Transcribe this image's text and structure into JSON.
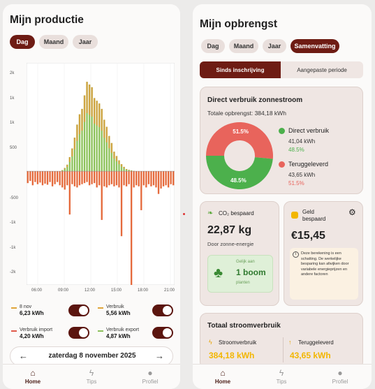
{
  "production": {
    "title": "Mijn productie",
    "tabs": [
      {
        "label": "Dag",
        "active": true
      },
      {
        "label": "Maand",
        "active": false
      },
      {
        "label": "Jaar",
        "active": false
      }
    ],
    "y_ticks": [
      "2k",
      "1k",
      "1k",
      "500",
      "-500",
      "-1k",
      "-1k",
      "-2k"
    ],
    "x_ticks": [
      "06:00",
      "09:00",
      "12:00",
      "15:00",
      "18:00",
      "21:00"
    ],
    "legend": [
      {
        "label": "8 nov",
        "value": "6,23 kWh",
        "color": "#e0a53a"
      },
      {
        "label": "Verbruik",
        "value": "5,56 kWh",
        "color": "#e0a53a"
      },
      {
        "label": "Verbruik import",
        "value": "4,20 kWh",
        "color": "#e05a4a"
      },
      {
        "label": "Verbruik export",
        "value": "4,87 kWh",
        "color": "#8cbf5a"
      }
    ],
    "date_label": "zaterdag 8 november 2025",
    "prev_icon": "arrow-left-icon",
    "next_icon": "arrow-right-icon"
  },
  "chart_data": {
    "type": "bar",
    "colors": {
      "production_top": "#e59a3a",
      "production_fill": "#8cc25a",
      "consumption": "#e56a3c"
    },
    "x": [
      "06:00",
      "09:00",
      "12:00",
      "15:00",
      "18:00",
      "21:00"
    ],
    "series": [
      {
        "values": [
          0,
          0,
          0,
          0,
          0,
          0,
          0,
          0,
          0,
          0,
          0,
          0,
          0,
          0,
          20,
          60,
          120,
          260,
          420,
          620,
          860,
          1050,
          1150,
          1400,
          1650,
          1600,
          1550,
          1350,
          1300,
          1250,
          1150,
          950,
          820,
          650,
          520,
          360,
          280,
          200,
          130,
          80,
          40,
          25,
          15,
          5,
          0,
          0,
          0,
          0,
          0,
          0,
          0,
          0,
          0,
          0,
          0,
          0,
          0,
          0,
          0,
          0
        ]
      },
      {
        "values": [
          -220,
          -180,
          -260,
          -200,
          -240,
          -210,
          -260,
          -230,
          -250,
          -200,
          -280,
          -240,
          -200,
          -260,
          -300,
          -340,
          -260,
          -800,
          -240,
          -280,
          -300,
          -260,
          -240,
          -220,
          -200,
          -260,
          -240,
          -220,
          -300,
          -260,
          -900,
          -280,
          -300,
          -260,
          -240,
          -280,
          -260,
          -300,
          -1200,
          -260,
          -280,
          -240,
          -2100,
          -300,
          -260,
          -280,
          -720,
          -260,
          -300,
          -240,
          -280,
          -260,
          -300,
          -420,
          -320,
          -280,
          -260,
          -300,
          -240,
          -260
        ]
      }
    ],
    "ylim": [
      -2100,
      2000
    ]
  },
  "revenue": {
    "title": "Mijn opbrengst",
    "tabs": [
      {
        "label": "Dag",
        "active": false
      },
      {
        "label": "Maand",
        "active": false
      },
      {
        "label": "Jaar",
        "active": false
      },
      {
        "label": "Samenvatting",
        "active": true
      }
    ],
    "segments": [
      {
        "label": "Sinds inschrijving",
        "active": true
      },
      {
        "label": "Aangepaste periode",
        "active": false
      }
    ],
    "direct": {
      "title": "Direct verbruik zonnestroom",
      "total": "Totale opbrengst: 384,18 kWh",
      "pie": [
        {
          "label": "Direct verbruik",
          "kwh": "41,04 kWh",
          "pct": "48.5%",
          "value": 48.5,
          "color": "#4cb04c"
        },
        {
          "label": "Teruggeleverd",
          "kwh": "43,65 kWh",
          "pct": "51.5%",
          "value": 51.5,
          "color": "#e8645c"
        }
      ],
      "pie_labels": [
        "51.5%",
        "48.5%"
      ]
    },
    "co2": {
      "label": "CO₂ bespaard",
      "value": "22,87 kg",
      "sub": "Door zonne-energie",
      "equal": "Gelijk aan",
      "trees": "1 boom",
      "trees_unit": "planten",
      "icon": "leaf-icon",
      "tree_icon": "tree-icon"
    },
    "money": {
      "label": "Geld bespaard",
      "value": "€15,45",
      "note": "Deze berekening is een schatting. De werkelijke besparing kan afwijken door variabele energieprijzen en andere factoren",
      "icon": "coin-icon",
      "settings_icon": "gear-icon",
      "info_icon": "info-icon"
    },
    "total": {
      "title": "Totaal stroomverbruik",
      "cons_label": "Stroomverbruik",
      "cons_value": "384,18 kWh",
      "ret_label": "Teruggeleverd",
      "ret_value": "43,65 kWh"
    }
  },
  "nav": [
    {
      "label": "Home",
      "icon": "home-icon",
      "active": true
    },
    {
      "label": "Tips",
      "icon": "bolt-icon",
      "active": false
    },
    {
      "label": "Profiel",
      "icon": "user-icon",
      "active": false
    }
  ]
}
